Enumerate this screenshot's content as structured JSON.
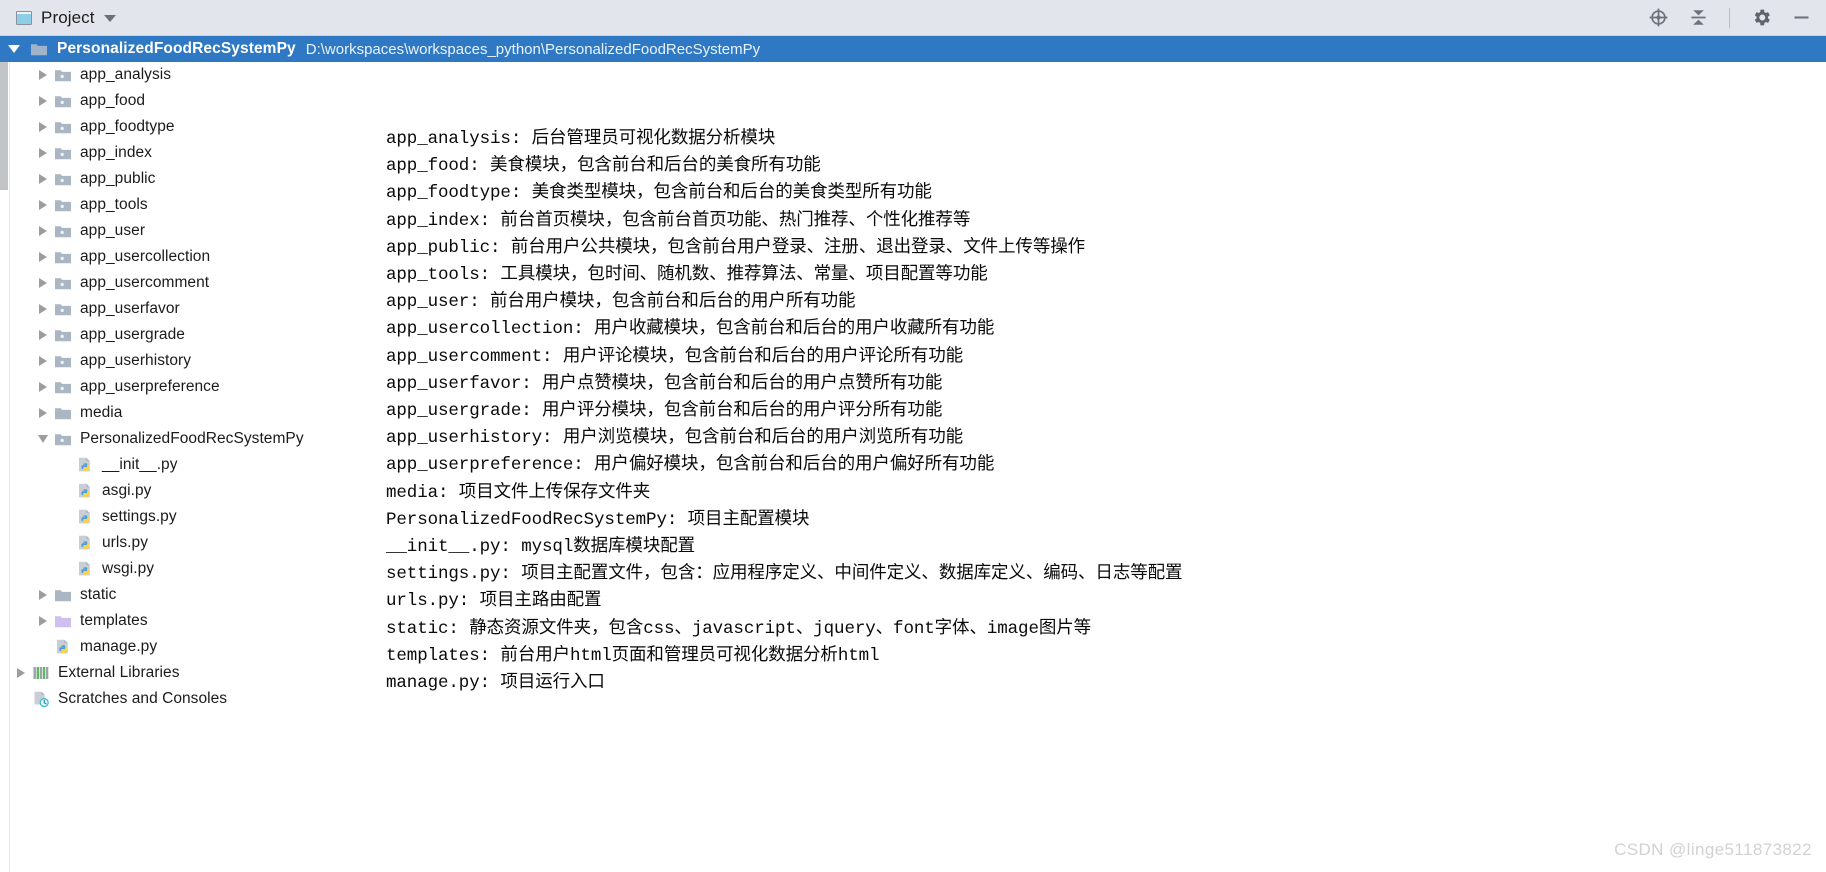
{
  "header": {
    "tab_label": "Project",
    "window_icon": "project-window-icon",
    "dropdown_icon": "chevron-down-icon",
    "actions": [
      {
        "name": "select-opened-file-icon",
        "title": "Select Opened File"
      },
      {
        "name": "collapse-all-icon",
        "title": "Collapse All"
      },
      {
        "name": "gear-icon",
        "title": "Settings"
      },
      {
        "name": "minimize-icon",
        "title": "Hide"
      }
    ]
  },
  "project_root": {
    "expander_icon": "triangle-down-icon",
    "folder_icon": "folder-icon",
    "name": "PersonalizedFoodRecSystemPy",
    "path": "D:\\workspaces\\workspaces_python\\PersonalizedFoodRecSystemPy"
  },
  "tree": {
    "items": [
      {
        "label": "app_analysis",
        "indent": 1,
        "arrow": "right",
        "icon": "module-folder-icon"
      },
      {
        "label": "app_food",
        "indent": 1,
        "arrow": "right",
        "icon": "module-folder-icon"
      },
      {
        "label": "app_foodtype",
        "indent": 1,
        "arrow": "right",
        "icon": "module-folder-icon"
      },
      {
        "label": "app_index",
        "indent": 1,
        "arrow": "right",
        "icon": "module-folder-icon"
      },
      {
        "label": "app_public",
        "indent": 1,
        "arrow": "right",
        "icon": "module-folder-icon"
      },
      {
        "label": "app_tools",
        "indent": 1,
        "arrow": "right",
        "icon": "module-folder-icon"
      },
      {
        "label": "app_user",
        "indent": 1,
        "arrow": "right",
        "icon": "module-folder-icon"
      },
      {
        "label": "app_usercollection",
        "indent": 1,
        "arrow": "right",
        "icon": "module-folder-icon"
      },
      {
        "label": "app_usercomment",
        "indent": 1,
        "arrow": "right",
        "icon": "module-folder-icon"
      },
      {
        "label": "app_userfavor",
        "indent": 1,
        "arrow": "right",
        "icon": "module-folder-icon"
      },
      {
        "label": "app_usergrade",
        "indent": 1,
        "arrow": "right",
        "icon": "module-folder-icon"
      },
      {
        "label": "app_userhistory",
        "indent": 1,
        "arrow": "right",
        "icon": "module-folder-icon"
      },
      {
        "label": "app_userpreference",
        "indent": 1,
        "arrow": "right",
        "icon": "module-folder-icon"
      },
      {
        "label": "media",
        "indent": 1,
        "arrow": "right",
        "icon": "folder-icon"
      },
      {
        "label": "PersonalizedFoodRecSystemPy",
        "indent": 1,
        "arrow": "down",
        "icon": "module-folder-icon"
      },
      {
        "label": "__init__.py",
        "indent": 2,
        "arrow": "none",
        "icon": "python-file-icon"
      },
      {
        "label": "asgi.py",
        "indent": 2,
        "arrow": "none",
        "icon": "python-file-icon"
      },
      {
        "label": "settings.py",
        "indent": 2,
        "arrow": "none",
        "icon": "python-file-icon"
      },
      {
        "label": "urls.py",
        "indent": 2,
        "arrow": "none",
        "icon": "python-file-icon"
      },
      {
        "label": "wsgi.py",
        "indent": 2,
        "arrow": "none",
        "icon": "python-file-icon"
      },
      {
        "label": "static",
        "indent": 1,
        "arrow": "right",
        "icon": "folder-icon"
      },
      {
        "label": "templates",
        "indent": 1,
        "arrow": "right",
        "icon": "templates-folder-icon"
      },
      {
        "label": "manage.py",
        "indent": 1,
        "arrow": "none",
        "icon": "python-file-icon"
      },
      {
        "label": "External Libraries",
        "indent": 0,
        "arrow": "right",
        "icon": "libraries-icon"
      },
      {
        "label": "Scratches and Consoles",
        "indent": 0,
        "arrow": "none",
        "icon": "scratches-icon"
      }
    ]
  },
  "description": {
    "lines": [
      "app_analysis: 后台管理员可视化数据分析模块",
      "app_food: 美食模块，包含前台和后台的美食所有功能",
      "app_foodtype: 美食类型模块，包含前台和后台的美食类型所有功能",
      "app_index: 前台首页模块，包含前台首页功能、热门推荐、个性化推荐等",
      "app_public: 前台用户公共模块，包含前台用户登录、注册、退出登录、文件上传等操作",
      "app_tools: 工具模块，包时间、随机数、推荐算法、常量、项目配置等功能",
      "app_user: 前台用户模块，包含前台和后台的用户所有功能",
      "app_usercollection: 用户收藏模块，包含前台和后台的用户收藏所有功能",
      "app_usercomment: 用户评论模块，包含前台和后台的用户评论所有功能",
      "app_userfavor: 用户点赞模块，包含前台和后台的用户点赞所有功能",
      "app_usergrade: 用户评分模块，包含前台和后台的用户评分所有功能",
      "app_userhistory: 用户浏览模块，包含前台和后台的用户浏览所有功能",
      "app_userpreference: 用户偏好模块，包含前台和后台的用户偏好所有功能",
      "media: 项目文件上传保存文件夹",
      "PersonalizedFoodRecSystemPy: 项目主配置模块",
      "__init__.py: mysql数据库模块配置",
      "settings.py: 项目主配置文件，包含：应用程序定义、中间件定义、数据库定义、编码、日志等配置",
      "urls.py: 项目主路由配置",
      "static: 静态资源文件夹，包含css、javascript、jquery、font字体、image图片等",
      "templates: 前台用户html页面和管理员可视化数据分析html",
      "manage.py: 项目运行入口"
    ]
  },
  "watermark": {
    "text": "CSDN @linge511873822"
  },
  "colors": {
    "selection_blue": "#2f79c4",
    "toolbar_bg": "#e2e5ec",
    "folder_gray": "#a7b0ba",
    "templates_purple": "#cdc0ee",
    "python_yellow": "#ffd33f",
    "python_blue": "#4b9fd6"
  }
}
